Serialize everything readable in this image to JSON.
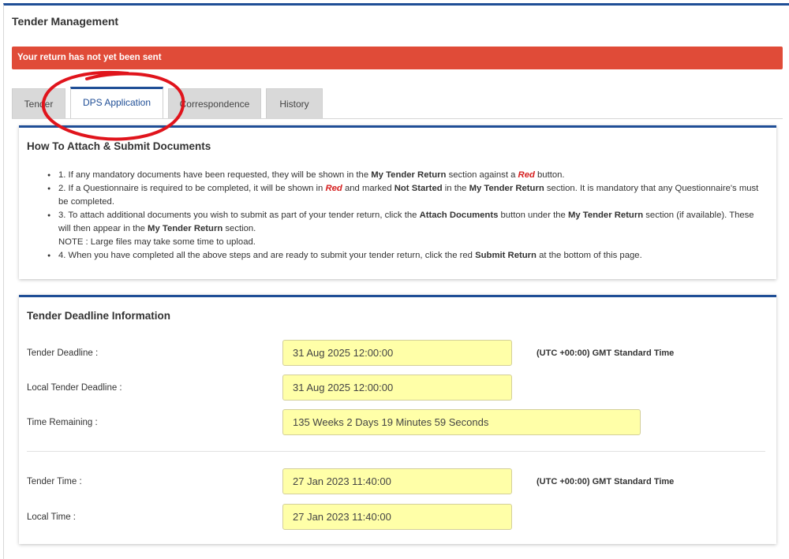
{
  "page": {
    "title": "Tender Management"
  },
  "alert": {
    "text": "Your return has not yet been sent",
    "color": "#e04b38"
  },
  "tabs": [
    {
      "label": "Tender",
      "active": false
    },
    {
      "label": "DPS Application",
      "active": true
    },
    {
      "label": "Correspondence",
      "active": false
    },
    {
      "label": "History",
      "active": false
    }
  ],
  "instructions": {
    "title": "How To Attach & Submit Documents",
    "items": [
      {
        "p1": "1. If any mandatory documents have been requested, they will be shown in the ",
        "b1": "My Tender Return",
        "p2": " section against a ",
        "r1": "Red",
        "p3": " button."
      },
      {
        "p1": "2. If a Questionnaire is required to be completed, it will be shown in ",
        "r1": "Red",
        "p2": " and marked ",
        "b1": "Not Started",
        "p3": " in the ",
        "b2": "My Tender Return",
        "p4": " section. It is mandatory that any Questionnaire's must be completed."
      },
      {
        "p1": "3. To attach additional documents you wish to submit as part of your tender return, click the ",
        "b1": "Attach Documents",
        "p2": " button under the ",
        "b2": "My Tender Return",
        "p3": " section (if available). These will then appear in the ",
        "b3": "My Tender Return",
        "p4": " section.",
        "note": "NOTE : Large files may take some time to upload."
      },
      {
        "p1": "4. When you have completed all the above steps and are ready to submit your tender return, click the red ",
        "b1": "Submit Return",
        "p2": " at the bottom of this page."
      }
    ]
  },
  "deadline": {
    "title": "Tender Deadline Information",
    "tender_deadline": {
      "label": "Tender Deadline :",
      "value": "31 Aug 2025 12:00:00",
      "tz": "(UTC +00:00) GMT Standard Time"
    },
    "local_deadline": {
      "label": "Local Tender Deadline :",
      "value": "31 Aug 2025 12:00:00"
    },
    "time_remaining": {
      "label": "Time Remaining :",
      "value": "135 Weeks 2 Days  19 Minutes 59 Seconds"
    },
    "tender_time": {
      "label": "Tender Time :",
      "value": "27 Jan 2023 11:40:00",
      "tz": "(UTC +00:00) GMT Standard Time"
    },
    "local_time": {
      "label": "Local Time :",
      "value": "27 Jan 2023 11:40:00"
    }
  },
  "colors": {
    "accent": "#1f4e96",
    "field_bg": "#ffffa8",
    "annotation": "#e0141c"
  }
}
